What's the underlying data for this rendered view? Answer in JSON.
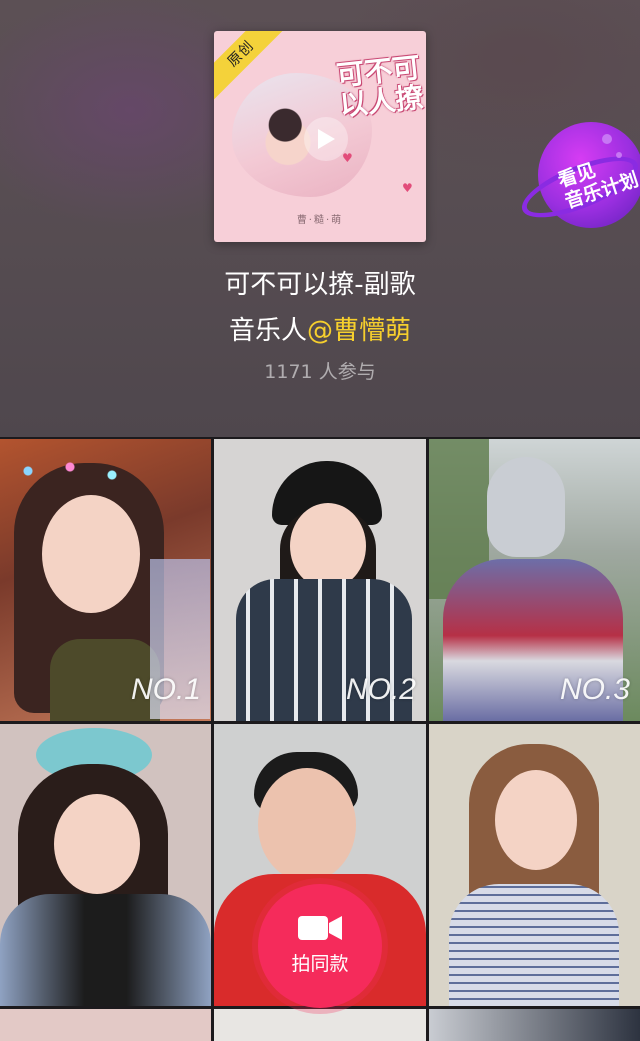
{
  "cover": {
    "badge": "原创",
    "title": "可不可以人撩",
    "artist": "曹·糙·萌"
  },
  "song": {
    "title": "可不可以撩-副歌",
    "artist_prefix": "音乐人",
    "artist_name": "@曹懵萌",
    "participants": "1171 人参与"
  },
  "promo_badge": {
    "line1": "看见",
    "line2": "音乐计划"
  },
  "videos": [
    {
      "rank": "NO.1"
    },
    {
      "rank": "NO.2"
    },
    {
      "rank": "NO.3"
    },
    {
      "rank": ""
    },
    {
      "rank": ""
    },
    {
      "rank": ""
    }
  ],
  "record_button": {
    "label": "拍同款"
  },
  "colors": {
    "accent": "#f52b5b",
    "artist_name": "#f6cf2d",
    "header_bg": "#574d52"
  },
  "icons": {
    "play": "play-icon",
    "record": "video-camera-icon"
  }
}
